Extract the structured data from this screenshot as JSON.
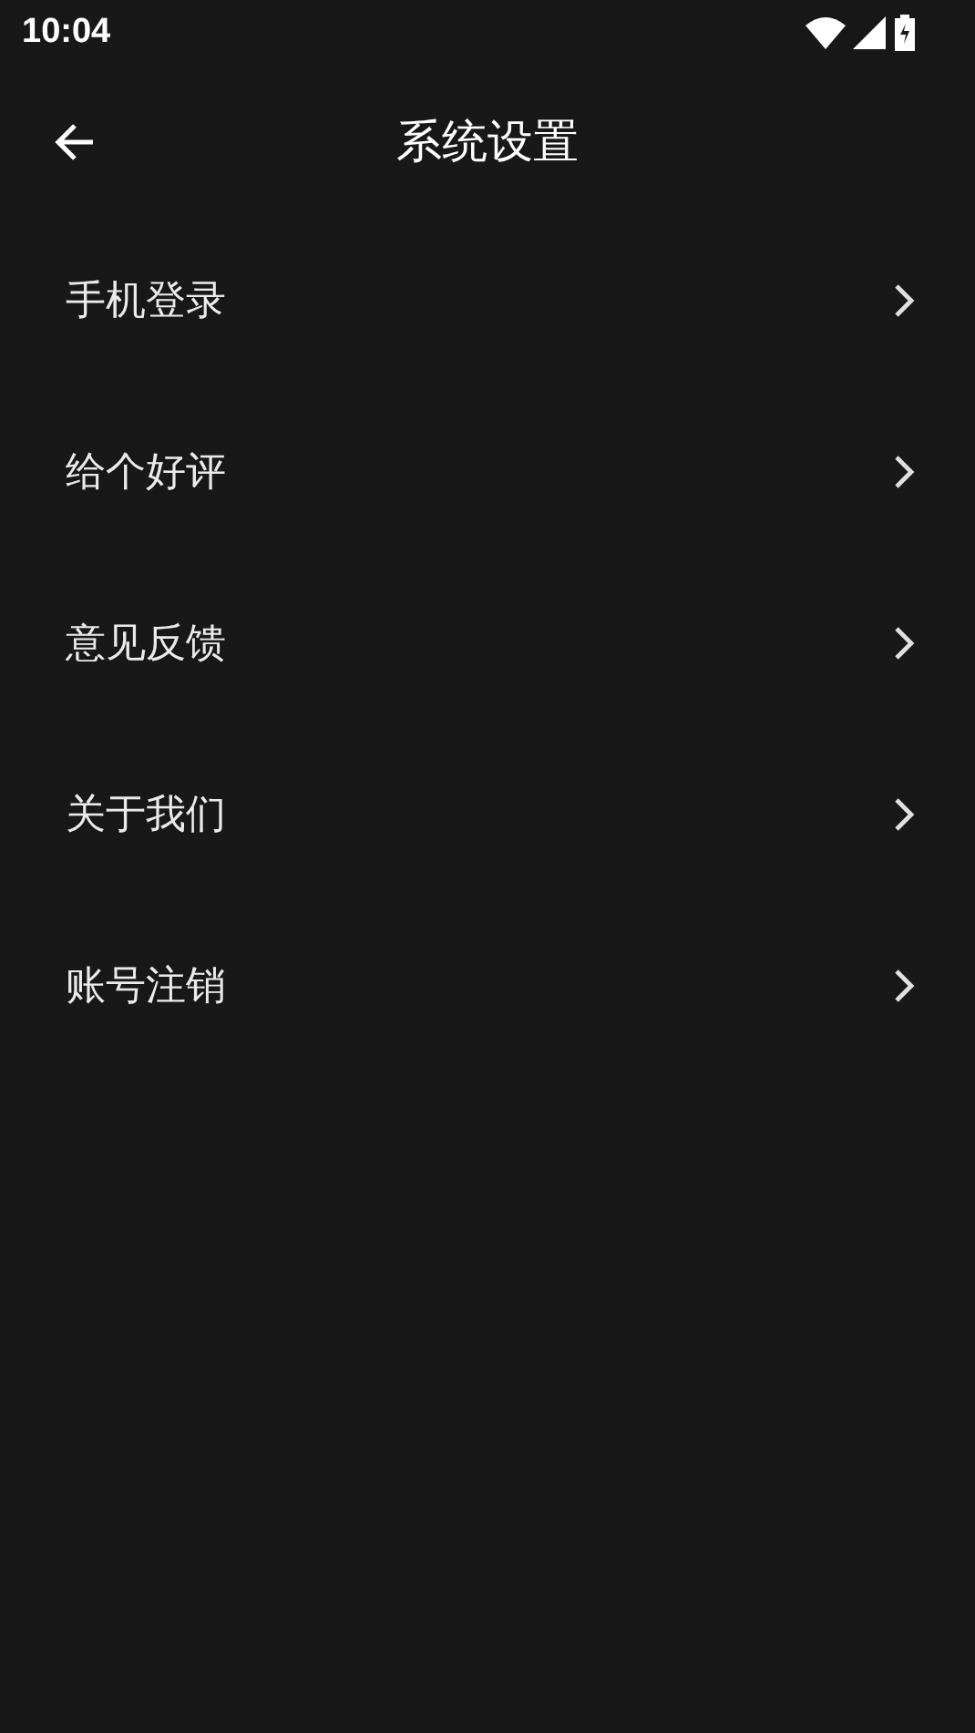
{
  "status_bar": {
    "time": "10:04"
  },
  "header": {
    "title": "系统设置"
  },
  "items": [
    {
      "label": "手机登录"
    },
    {
      "label": "给个好评"
    },
    {
      "label": "意见反馈"
    },
    {
      "label": "关于我们"
    },
    {
      "label": "账号注销"
    }
  ]
}
